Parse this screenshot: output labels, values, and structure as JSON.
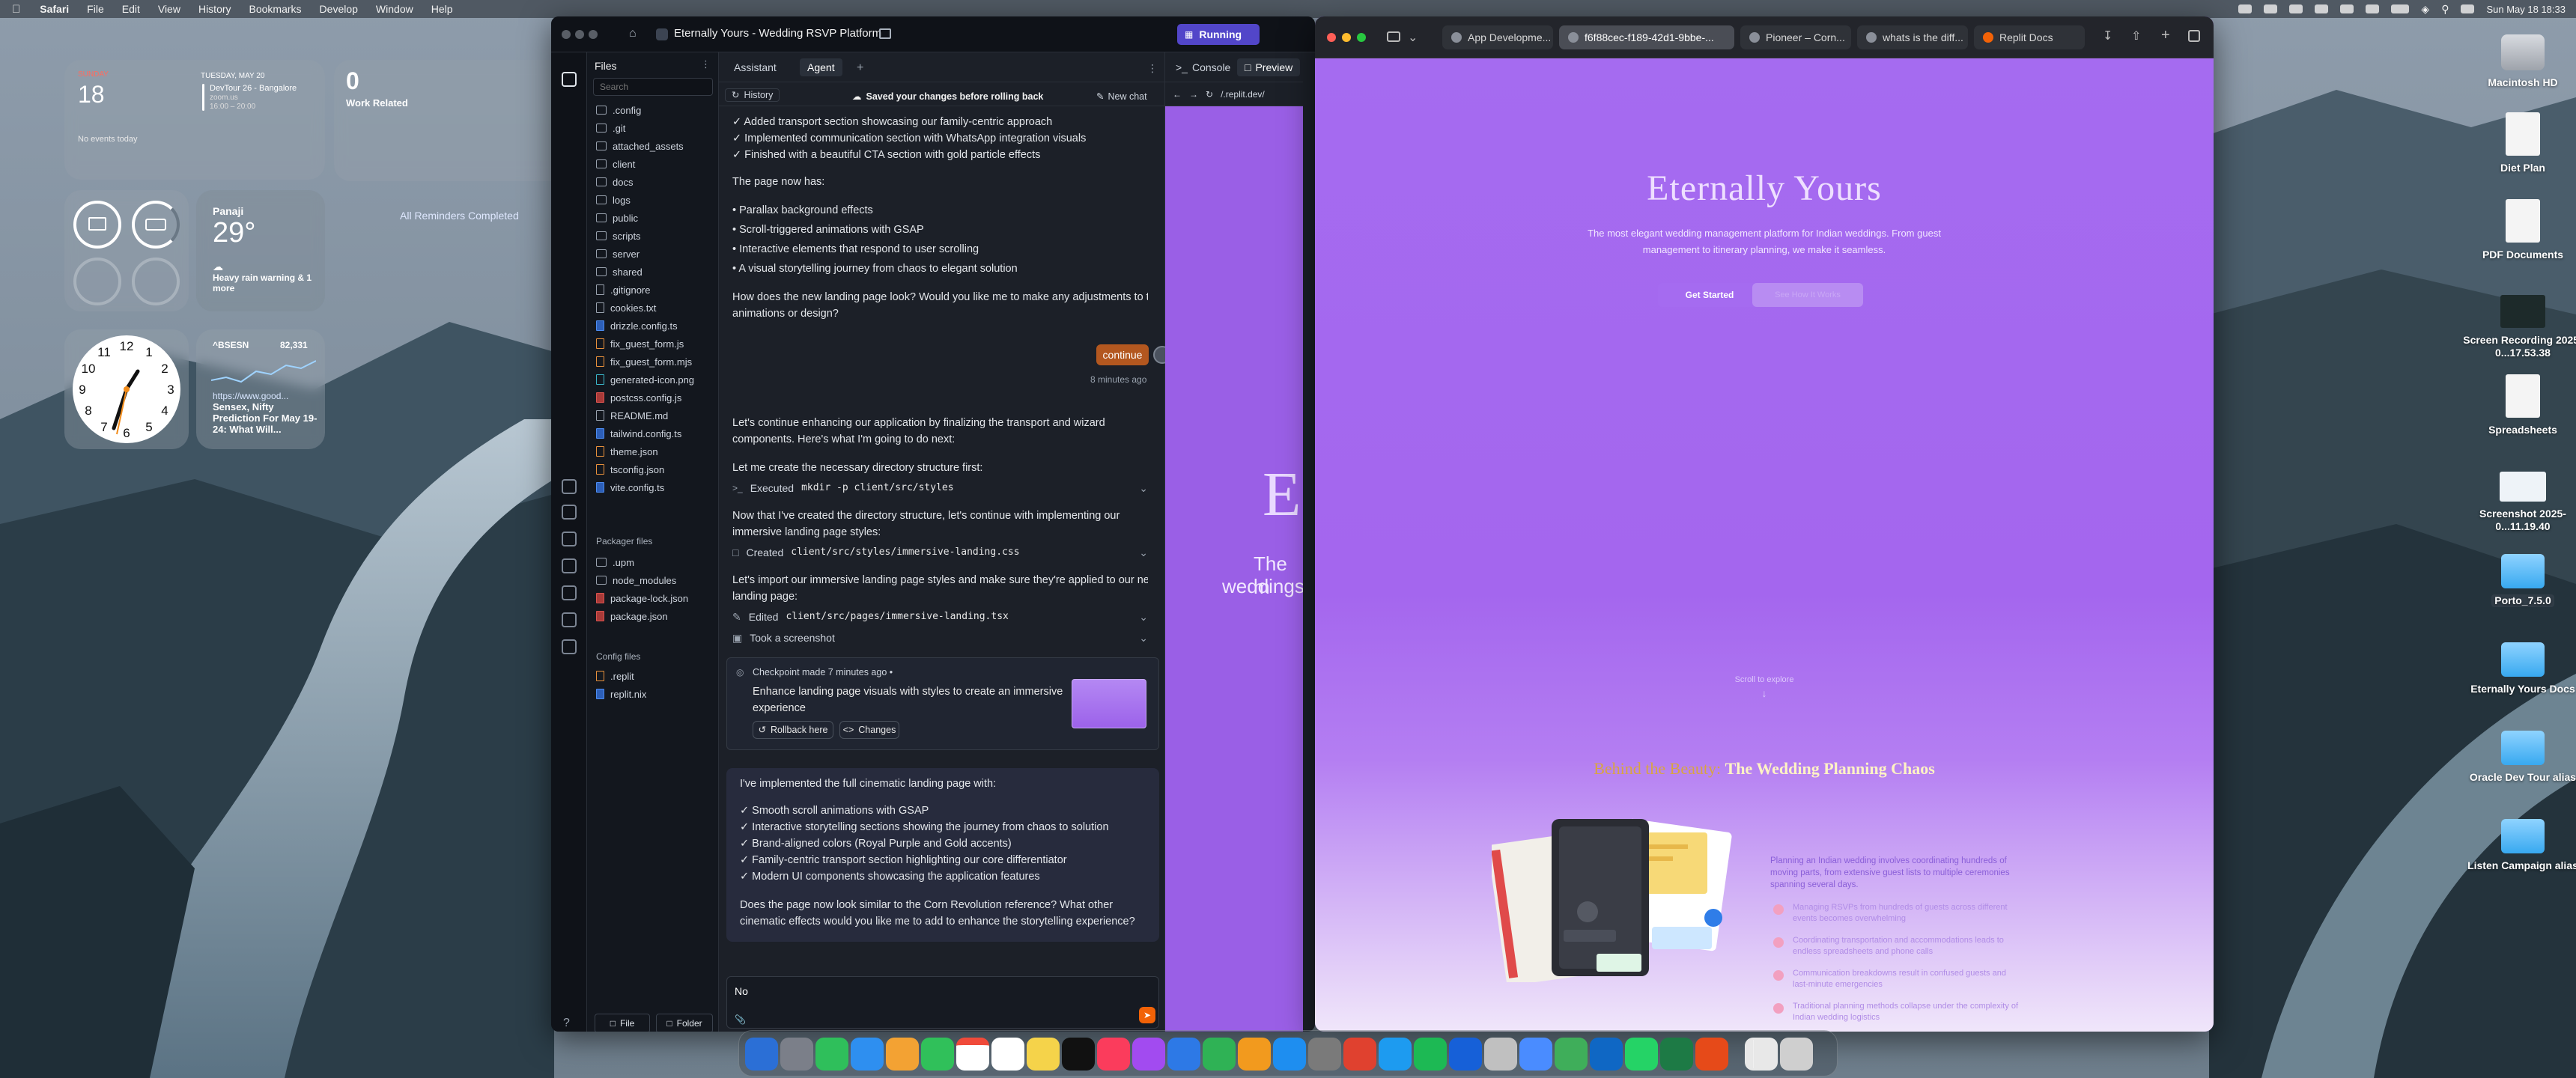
{
  "menubar": {
    "app": "Safari",
    "items": [
      "File",
      "Edit",
      "View",
      "History",
      "Bookmarks",
      "Develop",
      "Window",
      "Help"
    ],
    "clock": "Sun May 18 18:33"
  },
  "widgets": {
    "calendar": {
      "day_name": "SUNDAY",
      "day_num": "18",
      "next_date": "TUESDAY, MAY 20",
      "event_title": "DevTour 26 - Bangalore",
      "event_sub": "zoom.us",
      "event_time": "16:00 – 20:00",
      "no_events": "No events today"
    },
    "reminders": {
      "count": "0",
      "title": "Work Related",
      "done": "All Reminders Completed"
    },
    "weather": {
      "city": "Panaji",
      "temp": "29°",
      "alert": "Heavy rain warning & 1 more"
    },
    "stock": {
      "symbol": "^BSESN",
      "value": "82,331",
      "link": "https://www.good...",
      "headline": "Sensex, Nifty Prediction For May 19-24: What Will..."
    }
  },
  "replit": {
    "project_title": "Eternally Yours - Wedding RSVP Platform",
    "status": "Running",
    "files_panel": {
      "title": "Files",
      "search_placeholder": "Search",
      "items": [
        ".config",
        ".git",
        "attached_assets",
        "client",
        "docs",
        "logs",
        "public",
        "scripts",
        "server",
        "shared",
        ".gitignore",
        "cookies.txt",
        "drizzle.config.ts",
        "fix_guest_form.js",
        "fix_guest_form.mjs",
        "generated-icon.png",
        "postcss.config.js",
        "README.md",
        "tailwind.config.ts",
        "theme.json",
        "tsconfig.json",
        "vite.config.ts"
      ],
      "packager_title": "Packager files",
      "packager_items": [
        ".upm",
        "node_modules",
        "package-lock.json",
        "package.json"
      ],
      "config_title": "Config files",
      "config_items": [
        ".replit",
        "replit.nix"
      ],
      "file_button": "File",
      "folder_button": "Folder"
    },
    "tabs": {
      "assistant": "Assistant",
      "agent": "Agent",
      "console": "Console",
      "preview": "Preview"
    },
    "chat_header": {
      "history": "History",
      "saved": "Saved your changes before rolling back",
      "new_chat": "New chat"
    },
    "messages": {
      "top_list": [
        "✓ Added transport section showcasing our family-centric approach",
        "✓ Implemented communication section with WhatsApp integration visuals",
        "✓ Finished with a beautiful CTA section with gold particle effects"
      ],
      "page_has": "The page now has:",
      "bullets": [
        "Parallax background effects",
        "Scroll-triggered animations with GSAP",
        "Interactive elements that respond to user scrolling",
        "A visual storytelling journey from chaos to elegant solution"
      ],
      "question1a": "How does the new landing page look? Would you like me to make any adjustments to the",
      "question1b": "animations or design?",
      "user_bubble": "continue",
      "user_time": "8 minutes ago",
      "p1a": "Let's continue enhancing our application by finalizing the transport and wizard",
      "p1b": "components. Here's what I'm going to do next:",
      "p2": "Let me create the necessary directory structure first:",
      "tool1_label": "Executed",
      "tool1_code": "mkdir -p client/src/styles",
      "p3a": "Now that I've created the directory structure, let's continue with implementing our",
      "p3b": "immersive landing page styles:",
      "tool2_label": "Created",
      "tool2_code": "client/src/styles/immersive-landing.css",
      "p4a": "Let's import our immersive landing page styles and make sure they're applied to our new",
      "p4b": "landing page:",
      "tool3_label": "Edited",
      "tool3_code": "client/src/pages/immersive-landing.tsx",
      "tool4_label": "Took a screenshot",
      "checkpoint_meta": "Checkpoint made 7 minutes ago •",
      "checkpoint_text_a": "Enhance landing page visuals with styles to create an immersive",
      "checkpoint_text_b": "experience",
      "rollback": "Rollback here",
      "changes": "Changes",
      "final_intro": "I've implemented the full cinematic landing page with:",
      "final_list": [
        "✓ Smooth scroll animations with GSAP",
        "✓ Interactive storytelling sections showing the journey from chaos to solution",
        "✓ Brand-aligned colors (Royal Purple and Gold accents)",
        "✓ Family-centric transport section highlighting our core differentiator",
        "✓ Modern UI components showcasing the application features"
      ],
      "final_q_a": "Does the page now look similar to the Corn Revolution reference? What other",
      "final_q_b": "cinematic effects would you like me to add to enhance the storytelling experience?"
    },
    "input_value": "No",
    "preview_url": "/.replit.dev/",
    "preview_big_letter": "E",
    "preview_line1": "The m",
    "preview_line2": "weddings"
  },
  "safari": {
    "tabs": [
      "App Developme...",
      "f6f88cec-f189-42d1-9bbe-...",
      "Pioneer – Corn...",
      "whats is the diff...",
      "Replit Docs"
    ],
    "page": {
      "hero_title": "Eternally Yours",
      "hero_sub_a": "The most elegant wedding management platform for Indian weddings. From guest",
      "hero_sub_b": "management to itinerary planning, we make it seamless.",
      "get_started": "Get Started",
      "see_how": "See How It Works",
      "scroll": "Scroll to explore",
      "section_title_a": "Behind the Beauty:",
      "section_title_b": "The Wedding Planning Chaos",
      "intro_a": "Planning an Indian wedding involves coordinating hundreds of",
      "intro_b": "moving parts, from extensive guest lists to multiple ceremonies",
      "intro_c": "spanning several days.",
      "points": [
        [
          "Managing RSVPs from hundreds of guests across different",
          "events becomes overwhelming"
        ],
        [
          "Coordinating transportation and accommodations leads to",
          "endless spreadsheets and phone calls"
        ],
        [
          "Communication breakdowns result in confused guests and",
          "last-minute emergencies"
        ],
        [
          "Traditional planning methods collapse under the complexity of",
          "Indian wedding logistics"
        ]
      ]
    }
  },
  "desktop_icons": [
    {
      "label": "Macintosh HD"
    },
    {
      "label": "Diet Plan"
    },
    {
      "label": "PDF Documents"
    },
    {
      "label": "Screen Recording 2025-0...17.53.38"
    },
    {
      "label": "Spreadsheets"
    },
    {
      "label": "Screenshot 2025-0...11.19.40"
    },
    {
      "label": "Porto_7.5.0"
    },
    {
      "label": "Eternally Yours Docs"
    },
    {
      "label": "Oracle Dev Tour alias"
    },
    {
      "label": "Listen Campaign alias"
    }
  ],
  "colors": {
    "accent_orange": "#f26207",
    "preview_purple": "#a56bf0",
    "replit_bg": "#1c2028",
    "gold": "#d9a441"
  }
}
